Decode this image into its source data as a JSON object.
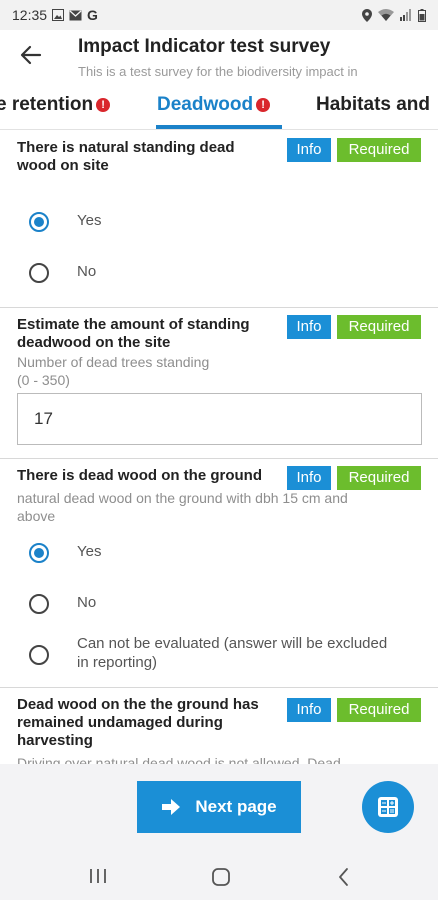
{
  "status_bar": {
    "time": "12:35",
    "left_icons": [
      "gallery-icon",
      "mail-icon",
      "google-icon"
    ],
    "google_label": "G",
    "right_icons": [
      "location-icon",
      "wifi-icon",
      "signal-icon",
      "battery-icon"
    ]
  },
  "header": {
    "title": "Impact Indicator test survey",
    "subtitle": "This is a test survey for the biodiversity impact in"
  },
  "tabs": [
    {
      "label": "e retention",
      "alert": "!",
      "active": false
    },
    {
      "label": "Deadwood",
      "alert": "!",
      "active": true
    },
    {
      "label": "Habitats and",
      "active": false
    }
  ],
  "questions": [
    {
      "title_lines": [
        "There is natural standing dead",
        "wood on site"
      ],
      "info_label": "Info",
      "required_label": "Required",
      "options": [
        {
          "label": "Yes",
          "selected": true
        },
        {
          "label": "No",
          "selected": false
        }
      ]
    },
    {
      "title_lines": [
        "Estimate the amount of standing",
        "deadwood on the site"
      ],
      "info_label": "Info",
      "required_label": "Required",
      "hint_lines": [
        "Number of dead trees standing",
        "(0 - 350)"
      ],
      "input_value": "17"
    },
    {
      "title_lines": [
        "There is dead wood on the ground"
      ],
      "info_label": "Info",
      "required_label": "Required",
      "hint_lines": [
        "natural dead wood on the ground with dbh 15 cm and",
        "above"
      ],
      "options": [
        {
          "label": "Yes",
          "selected": true
        },
        {
          "label": "No",
          "selected": false
        },
        {
          "label_lines": [
            "Can not be evaluated (answer will be excluded",
            "in reporting)"
          ],
          "selected": false
        }
      ]
    },
    {
      "title_lines": [
        "Dead wood on the the ground has",
        "remained undamaged during",
        "harvesting"
      ],
      "info_label": "Info",
      "required_label": "Required",
      "hint_lines": [
        "Driving over natural dead wood is not allowed.  Dead"
      ]
    }
  ],
  "footer": {
    "next_label": "Next page",
    "next_icon": "arrow-right-icon",
    "fab_icon": "calculator-icon"
  },
  "nav_bar": {
    "icons": [
      "recents-icon",
      "home-icon",
      "back-icon"
    ]
  },
  "colors": {
    "accent": "#1b82c9",
    "info_button": "#1b8fd6",
    "required_badge": "#6cbd2d",
    "alert": "#d9262c"
  }
}
